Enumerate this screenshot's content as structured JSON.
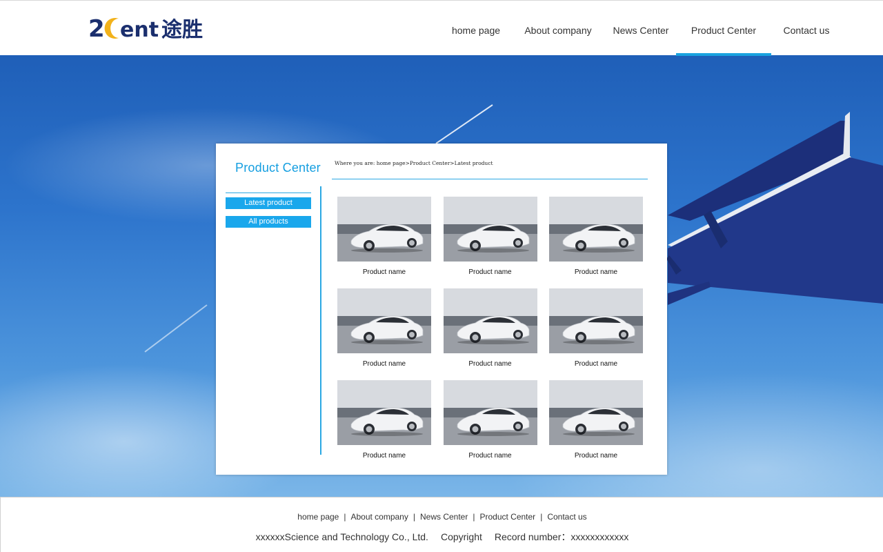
{
  "brand": {
    "logo_text": "2ent途胜",
    "accent_color": "#1aa3e0",
    "logo_color": "#1b2f6e",
    "moon_color": "#f2b21b"
  },
  "nav": {
    "items": [
      {
        "label": "home page"
      },
      {
        "label": "About company"
      },
      {
        "label": "News Center"
      },
      {
        "label": "Product Center",
        "active": true
      },
      {
        "label": "Contact us"
      }
    ]
  },
  "panel": {
    "title": "Product Center",
    "breadcrumb": {
      "prefix": "Where you are: ",
      "items": [
        "home page",
        "Product Center",
        "Latest product"
      ],
      "separator": ">"
    },
    "sidebar": {
      "items": [
        {
          "label": "Latest product"
        },
        {
          "label": "All products"
        }
      ]
    },
    "products": [
      {
        "name": "Product name",
        "image": "white-sports-car"
      },
      {
        "name": "Product name",
        "image": "white-sports-car"
      },
      {
        "name": "Product name",
        "image": "white-sports-car"
      },
      {
        "name": "Product name",
        "image": "white-sports-car"
      },
      {
        "name": "Product name",
        "image": "white-sports-car"
      },
      {
        "name": "Product name",
        "image": "white-sports-car"
      },
      {
        "name": "Product name",
        "image": "white-sports-car"
      },
      {
        "name": "Product name",
        "image": "white-sports-car"
      },
      {
        "name": "Product name",
        "image": "white-sports-car"
      }
    ]
  },
  "footer": {
    "links": [
      "home page",
      "About company",
      "News Center",
      "Product Center",
      "Contact us"
    ],
    "separator": "|",
    "company": "xxxxxxScience and Technology Co., Ltd.",
    "copyright": "Copyright",
    "record": "Record number：xxxxxxxxxxxx"
  },
  "background": {
    "image": "blue-sky-airplane-wing"
  }
}
